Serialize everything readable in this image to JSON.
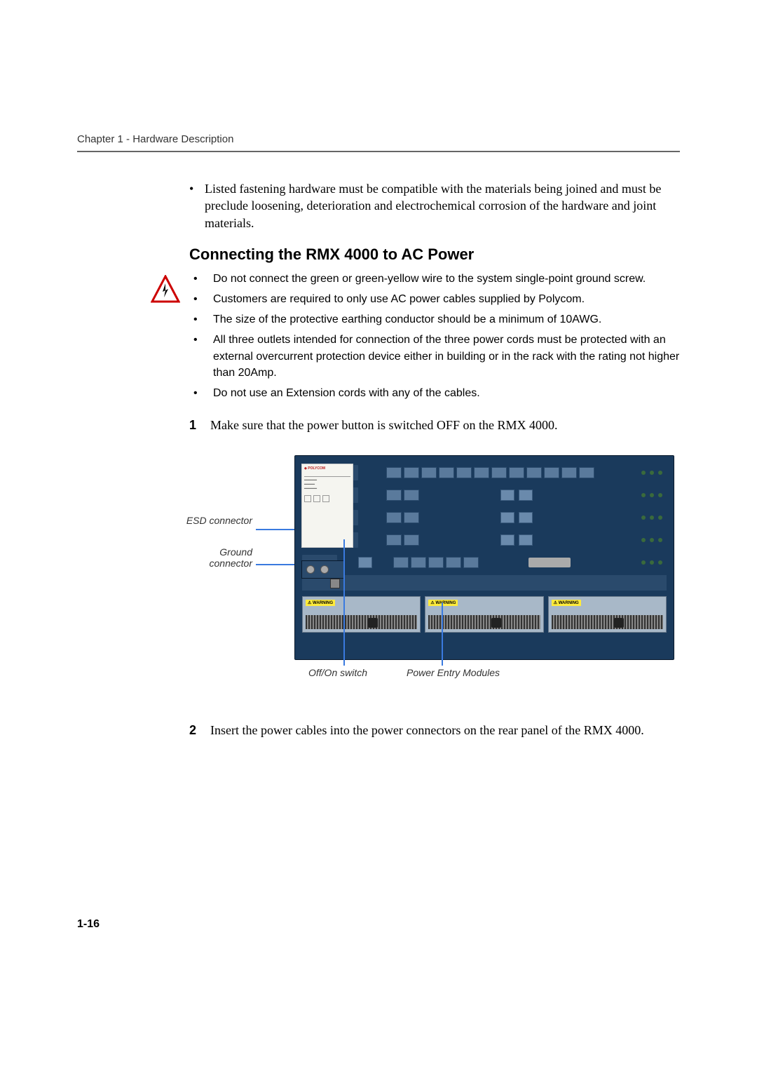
{
  "header": {
    "chapter_title": "Chapter 1 - Hardware Description"
  },
  "intro": {
    "bullet1": "Listed fastening hardware must be compatible with the materials being joined and must be preclude loosening, deterioration and electrochemical corrosion of the hardware and joint materials."
  },
  "section": {
    "heading": "Connecting the RMX 4000 to AC Power"
  },
  "warnings": {
    "item1": "Do not connect the green or green-yellow wire to the system single-point ground screw.",
    "item2": "Customers are required to only use AC power cables supplied by Polycom.",
    "item3": "The size of the protective earthing conductor should be a minimum of 10AWG.",
    "item4": "All three outlets intended for connection of the three power cords must be protected with an external overcurrent protection device either in building or in the rack with the rating not higher than 20Amp.",
    "item5": "Do not use an Extension cords with any of the cables."
  },
  "steps": {
    "num1": "1",
    "text1": "Make sure that the power button is switched OFF on the RMX 4000.",
    "num2": "2",
    "text2": "Insert the power cables into the power connectors on the rear panel of the RMX 4000."
  },
  "figure": {
    "callout_esd": "ESD connector",
    "callout_ground": "Ground connector",
    "callout_switch": "Off/On switch",
    "callout_pem": "Power Entry Modules",
    "brand": "POLYCOM",
    "psu_warn": "WARNING"
  },
  "page_number": "1-16"
}
